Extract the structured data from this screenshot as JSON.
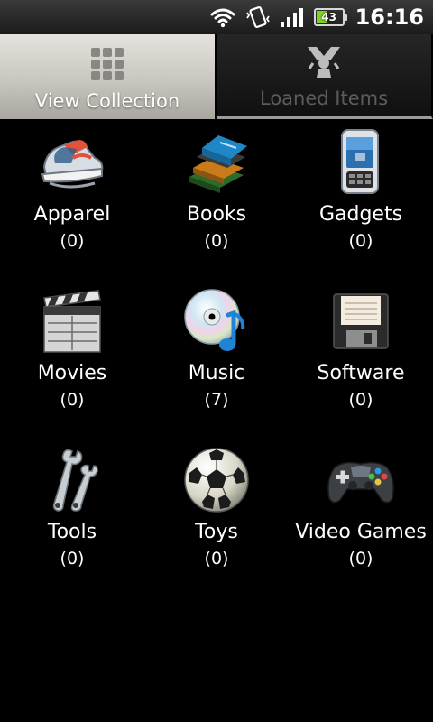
{
  "status_bar": {
    "icons": [
      "wifi-icon",
      "vibrate-icon",
      "signal-icon",
      "battery-icon"
    ],
    "battery_level": "43",
    "time": "16:16",
    "battery_color": "#7ed321"
  },
  "tabs": [
    {
      "label": "View Collection",
      "icon": "grid-icon",
      "active": true
    },
    {
      "label": "Loaned Items",
      "icon": "loaned-icon",
      "active": false
    }
  ],
  "categories": [
    {
      "name": "Apparel",
      "count": "(0)",
      "icon": "sneakers-icon"
    },
    {
      "name": "Books",
      "count": "(0)",
      "icon": "books-icon"
    },
    {
      "name": "Gadgets",
      "count": "(0)",
      "icon": "phone-icon"
    },
    {
      "name": "Movies",
      "count": "(0)",
      "icon": "clapperboard-icon"
    },
    {
      "name": "Music",
      "count": "(7)",
      "icon": "cd-music-icon"
    },
    {
      "name": "Software",
      "count": "(0)",
      "icon": "floppy-disk-icon"
    },
    {
      "name": "Tools",
      "count": "(0)",
      "icon": "wrenches-icon"
    },
    {
      "name": "Toys",
      "count": "(0)",
      "icon": "soccer-ball-icon"
    },
    {
      "name": "Video Games",
      "count": "(0)",
      "icon": "gamepad-icon"
    }
  ]
}
